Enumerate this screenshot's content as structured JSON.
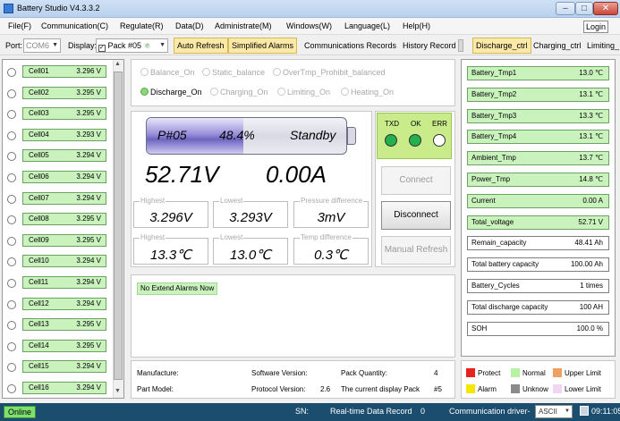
{
  "app": {
    "title": "Battery Studio V4.3.3.2"
  },
  "menu": [
    "File(F)",
    "Communication(C)",
    "Regulate(R)",
    "Data(D)",
    "Administrate(M)",
    "Windows(W)",
    "Language(L)",
    "Help(H)"
  ],
  "login_label": "Login",
  "toolbar": {
    "port_label": "Port:",
    "port_value": "COM6",
    "display_label": "Display:",
    "display_value": "Pack #05",
    "auto_refresh": "Auto Refresh",
    "simplified_alarms": "Simplified Alarms",
    "comm_records": "Communications Records",
    "history_record": "History Record",
    "discharge_ctrl": "Discharge_ctrl",
    "charging_ctrl": "Charging_ctrl",
    "limiting": "Limiting_"
  },
  "cells": [
    {
      "name": "Cell01",
      "value": "3.296 V"
    },
    {
      "name": "Cell02",
      "value": "3.295 V"
    },
    {
      "name": "Cell03",
      "value": "3.295 V"
    },
    {
      "name": "Cell04",
      "value": "3.293 V"
    },
    {
      "name": "Cell05",
      "value": "3.294 V"
    },
    {
      "name": "Cell06",
      "value": "3.294 V"
    },
    {
      "name": "Cell07",
      "value": "3.294 V"
    },
    {
      "name": "Cell08",
      "value": "3.295 V"
    },
    {
      "name": "Cell09",
      "value": "3.295 V"
    },
    {
      "name": "Cell10",
      "value": "3.294 V"
    },
    {
      "name": "Cell11",
      "value": "3.294 V"
    },
    {
      "name": "Cell12",
      "value": "3.294 V"
    },
    {
      "name": "Cell13",
      "value": "3.295 V"
    },
    {
      "name": "Cell14",
      "value": "3.295 V"
    },
    {
      "name": "Cell15",
      "value": "3.294 V"
    },
    {
      "name": "Cell16",
      "value": "3.294 V"
    }
  ],
  "status_options": {
    "balance_on": "Balance_On",
    "static_balance": "Static_balance",
    "overtmp": "OverTmp_Prohibit_balanced",
    "discharge_on": "Discharge_On",
    "charging_on": "Charging_On",
    "limiting_on": "Limiting_On",
    "heating_on": "Heating_On"
  },
  "battery": {
    "pack": "P#05",
    "percent": "48.4%",
    "fill_fraction": 0.484,
    "state": "Standby"
  },
  "voltage": "52.71V",
  "current": "0.00A",
  "voltage_stats": {
    "highest_label": "Highest",
    "highest": "3.296V",
    "lowest_label": "Lowest",
    "lowest": "3.293V",
    "diff_label": "Pressure difference",
    "diff": "3mV"
  },
  "temp_stats": {
    "highest_label": "Highest",
    "highest": "13.3℃",
    "lowest_label": "Lowest",
    "lowest": "13.0℃",
    "diff_label": "Temp difference",
    "diff": "0.3℃"
  },
  "leds": {
    "txd": "TXD",
    "ok": "OK",
    "err": "ERR"
  },
  "buttons": {
    "connect": "Connect",
    "disconnect": "Disconnect",
    "manual_refresh": "Manual Refresh"
  },
  "alarm_text": "No Extend Alarms Now",
  "right_items": [
    {
      "name": "Battery_Tmp1",
      "value": "13.0 ℃",
      "green": true
    },
    {
      "name": "Battery_Tmp2",
      "value": "13.1 ℃",
      "green": true
    },
    {
      "name": "Battery_Tmp3",
      "value": "13.3 ℃",
      "green": true
    },
    {
      "name": "Battery_Tmp4",
      "value": "13.1 ℃",
      "green": true
    },
    {
      "name": "Ambient_Tmp",
      "value": "13.7 ℃",
      "green": true
    },
    {
      "name": "Power_Tmp",
      "value": "14.8 ℃",
      "green": true
    },
    {
      "name": "Current",
      "value": "0.00 A",
      "green": true
    },
    {
      "name": "Total_voltage",
      "value": "52.71 V",
      "green": true
    },
    {
      "name": "Remain_capacity",
      "value": "48.41 Ah",
      "green": false
    },
    {
      "name": "Total battery capacity",
      "value": "100.00 Ah",
      "green": false
    },
    {
      "name": "Battery_Cycles",
      "value": "1 times",
      "green": false
    },
    {
      "name": "Total discharge capacity",
      "value": "100 AH",
      "green": false
    },
    {
      "name": "SOH",
      "value": "100.0 %",
      "green": false
    }
  ],
  "info": {
    "manufacture_label": "Manufacture:",
    "part_model_label": "Part Model:",
    "software_version_label": "Software Version:",
    "protocol_version_label": "Protocol Version:",
    "protocol_version": "2.6",
    "pack_quantity_label": "Pack Quantity:",
    "pack_quantity": "4",
    "current_pack_label": "The current display Pack",
    "current_pack": "#5"
  },
  "legend": [
    {
      "label": "Protect",
      "color": "#e8231d"
    },
    {
      "label": "Normal",
      "color": "#b7f2a7"
    },
    {
      "label": "Upper Limit",
      "color": "#f0a060"
    },
    {
      "label": "Alarm",
      "color": "#f5e700"
    },
    {
      "label": "Unknow",
      "color": "#8a8a8a"
    },
    {
      "label": "Lower Limit",
      "color": "#f0d6f0"
    }
  ],
  "statusbar": {
    "online": "Online",
    "sn": "SN:",
    "realtime": "Real-time Data Record",
    "realtime_count": "0",
    "comm_driver": "Communication driver-",
    "driver_value": "ASCII",
    "time": "09:11:05"
  }
}
